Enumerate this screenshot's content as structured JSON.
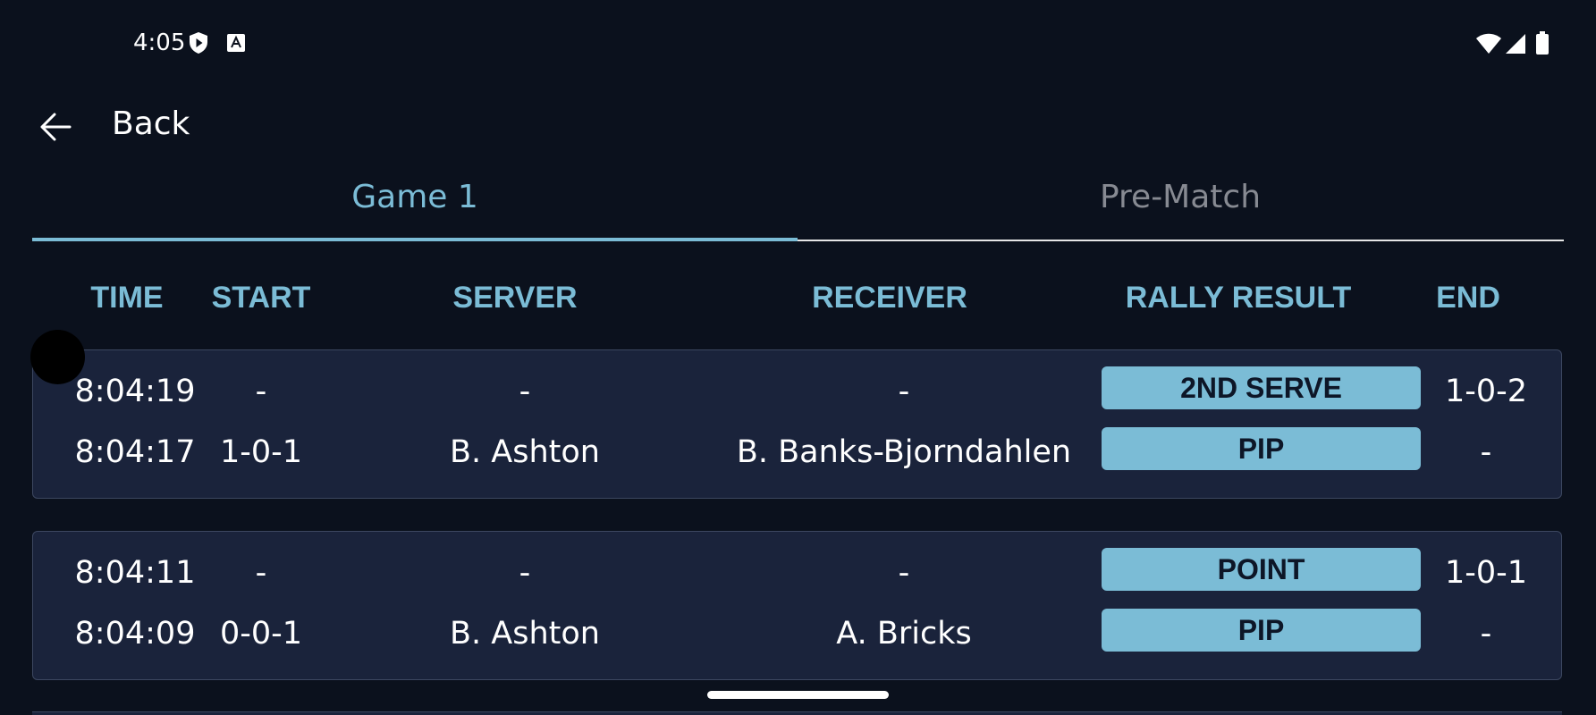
{
  "status_bar": {
    "time": "4:05"
  },
  "nav": {
    "back_label": "Back"
  },
  "tabs": [
    {
      "label": "Game 1",
      "selected": true
    },
    {
      "label": "Pre-Match",
      "selected": false
    }
  ],
  "table": {
    "headers": {
      "time": "TIME",
      "start": "START",
      "server": "SERVER",
      "receiver": "RECEIVER",
      "rally_result": "RALLY RESULT",
      "end": "END"
    },
    "groups": [
      {
        "rows": [
          {
            "time": "8:04:19",
            "start": "-",
            "server": "-",
            "receiver": "-",
            "rally_result": "2ND SERVE",
            "end": "1-0-2"
          },
          {
            "time": "8:04:17",
            "start": "1-0-1",
            "server": "B. Ashton",
            "receiver": "B. Banks-Bjorndahlen",
            "rally_result": "PIP",
            "end": "-"
          }
        ]
      },
      {
        "rows": [
          {
            "time": "8:04:11",
            "start": "-",
            "server": "-",
            "receiver": "-",
            "rally_result": "POINT",
            "end": "1-0-1"
          },
          {
            "time": "8:04:09",
            "start": "0-0-1",
            "server": "B. Ashton",
            "receiver": "A. Bricks",
            "rally_result": "PIP",
            "end": "-"
          }
        ]
      }
    ]
  },
  "colors": {
    "background": "#0b111d",
    "card": "#1a233b",
    "accent": "#7bbcd6",
    "inactive_tab": "#878a92"
  },
  "icons": [
    "shield-play-icon",
    "font-a-icon",
    "wifi-icon",
    "cellular-signal-icon",
    "battery-icon",
    "back-arrow-icon"
  ]
}
